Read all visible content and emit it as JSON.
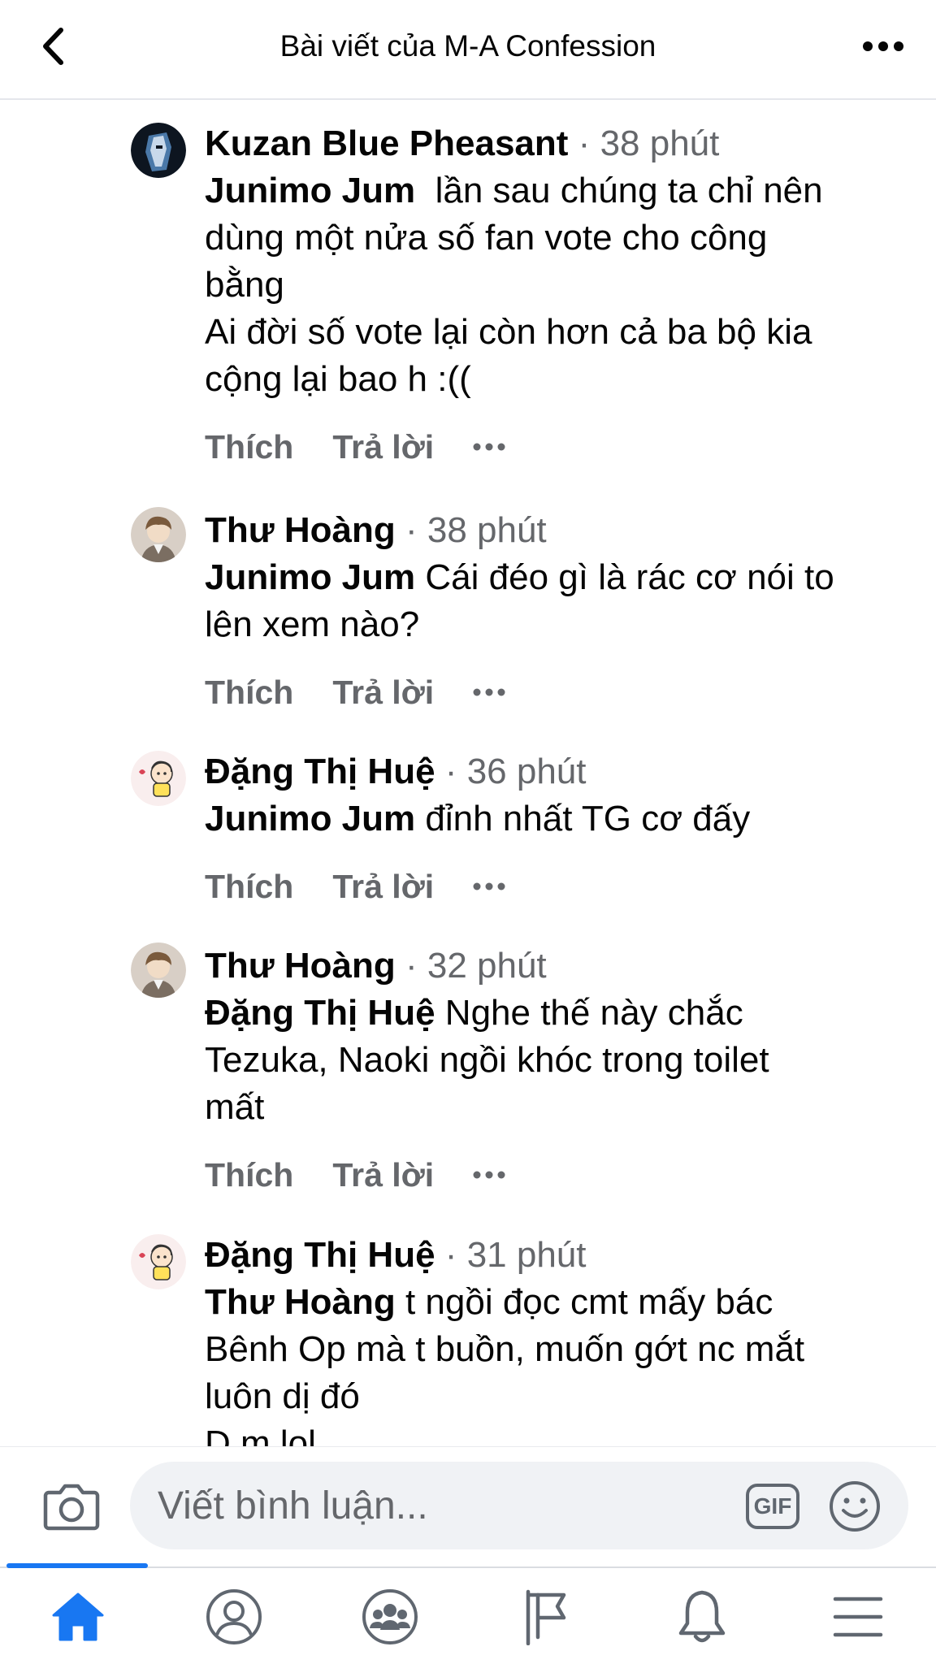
{
  "header": {
    "back_icon": "chevron-left-icon",
    "title": "Bài viết của M-A Confession",
    "more_icon": "more-horizontal-icon"
  },
  "comments": [
    {
      "author": "Kuzan Blue Pheasant",
      "separator": "·",
      "time": "38 phút",
      "mention": "Junimo Jum",
      "lines": [
        "lần sau chúng ta chỉ nên",
        "dùng một nửa số fan vote cho công",
        "bằng",
        "Ai đời số vote lại còn hơn cả ba bộ kia",
        "cộng lại bao h :(("
      ],
      "like": "Thích",
      "reply": "Trả lời"
    },
    {
      "author": "Thư Hoàng",
      "separator": "·",
      "time": "38 phút",
      "mention": "Junimo Jum",
      "lines": [
        "Cái đéo gì là rác cơ nói to",
        "lên xem nào?"
      ],
      "like": "Thích",
      "reply": "Trả lời"
    },
    {
      "author": "Đặng Thị Huệ",
      "separator": "·",
      "time": "36 phút",
      "mention": "Junimo Jum",
      "lines": [
        "đỉnh nhất TG cơ đấy"
      ],
      "like": "Thích",
      "reply": "Trả lời"
    },
    {
      "author": "Thư Hoàng",
      "separator": "·",
      "time": "32 phút",
      "mention": "Đặng Thị Huệ",
      "lines": [
        "Nghe thế này chắc",
        "Tezuka, Naoki ngồi khóc trong toilet",
        "mất"
      ],
      "like": "Thích",
      "reply": "Trả lời"
    },
    {
      "author": "Đặng Thị Huệ",
      "separator": "·",
      "time": "31 phút",
      "mention": "Thư Hoàng",
      "lines": [
        "t ngồi đọc cmt mấy bác",
        "Bênh Op mà t buồn, muốn gớt nc mắt",
        "luôn dị đó",
        "D m lol"
      ]
    }
  ],
  "composer": {
    "placeholder": "Viết bình luận...",
    "camera_icon": "camera-icon",
    "gif_label": "GIF",
    "emoji_icon": "smiley-icon"
  },
  "tabbar": {
    "active": "home",
    "tabs": [
      "home-icon",
      "profile-icon",
      "groups-icon",
      "pages-flag-icon",
      "notifications-bell-icon",
      "menu-icon"
    ]
  },
  "colors": {
    "accent": "#1877f2",
    "secondary_text": "#65676b",
    "input_bg": "#f0f2f5"
  }
}
